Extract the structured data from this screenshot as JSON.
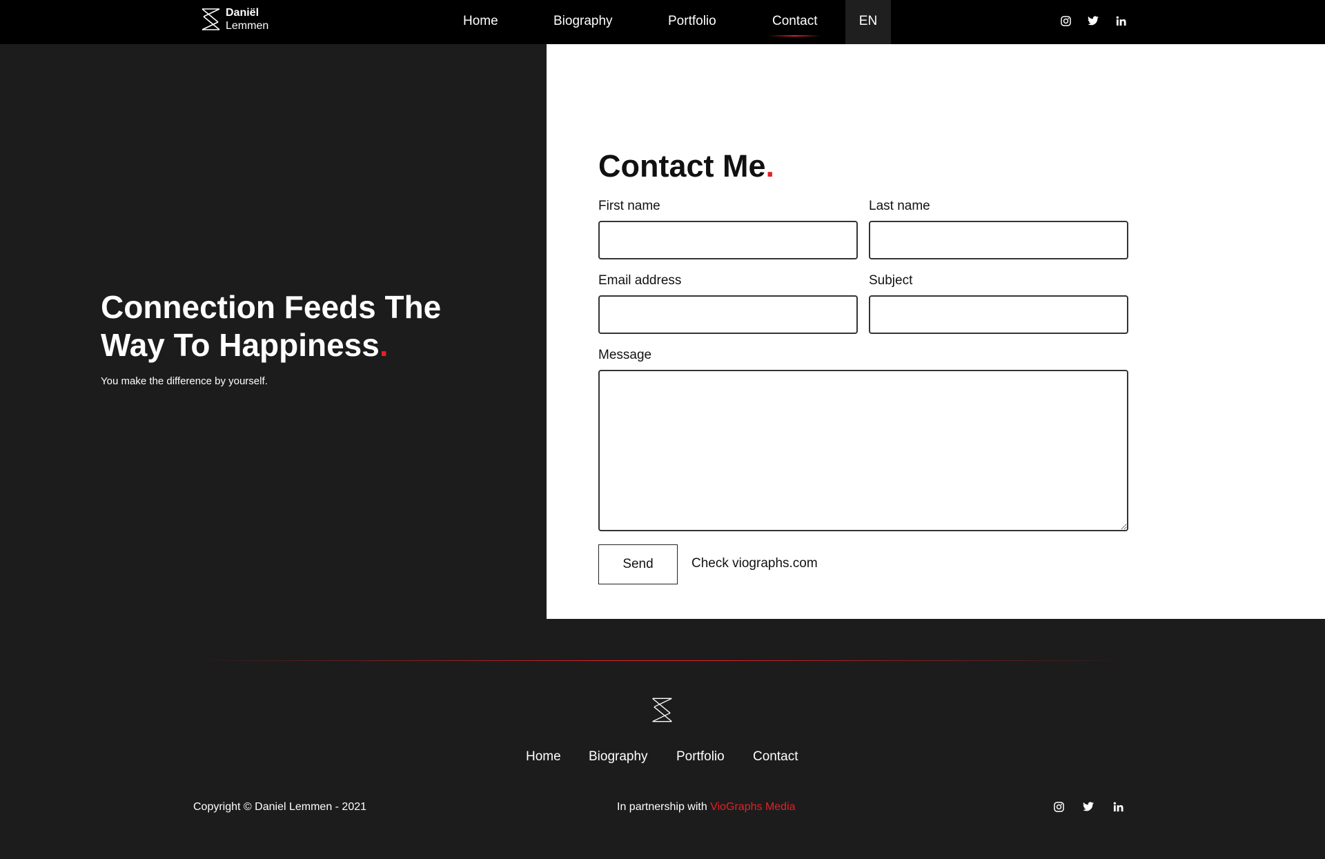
{
  "brand": {
    "first_name": "Daniël",
    "last_name": "Lemmen"
  },
  "nav": {
    "items": [
      "Home",
      "Biography",
      "Portfolio",
      "Contact"
    ],
    "active": "Contact",
    "language": "EN"
  },
  "social": [
    "instagram-icon",
    "twitter-icon",
    "linkedin-icon"
  ],
  "hero": {
    "title_line1": "Connection Feeds The",
    "title_line2": "Way To Happiness",
    "title_dot": ".",
    "subtitle": "You make the difference by yourself."
  },
  "contact": {
    "title": "Contact Me",
    "title_dot": ".",
    "first_name_label": "First name",
    "last_name_label": "Last name",
    "email_label": "Email address",
    "subject_label": "Subject",
    "message_label": "Message",
    "first_name_value": "",
    "last_name_value": "",
    "email_value": "",
    "subject_value": "",
    "message_value": "",
    "send_label": "Send",
    "check_text": "Check viographs.com"
  },
  "footer": {
    "nav": [
      "Home",
      "Biography",
      "Portfolio",
      "Contact"
    ],
    "copyright": "Copyright © Daniel Lemmen - 2021",
    "partner_prefix": "In partnership with",
    "partner_brand": "VioGraphs Media"
  },
  "colors": {
    "accent": "#e52028",
    "background": "#1c1c1c",
    "header": "#000000",
    "panel": "#ffffff"
  }
}
